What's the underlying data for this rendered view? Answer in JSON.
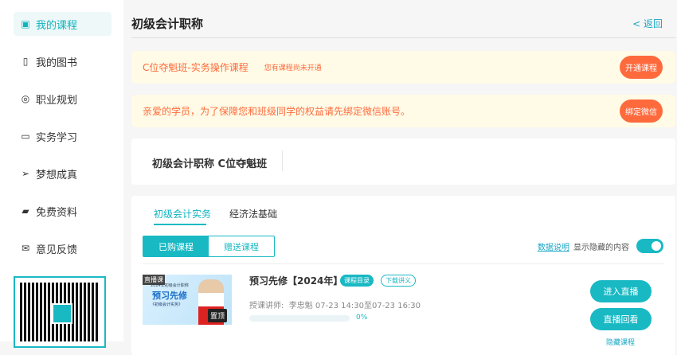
{
  "sidebar": {
    "items": [
      {
        "label": "我的课程",
        "icon": "bookmark-icon"
      },
      {
        "label": "我的图书",
        "icon": "book-icon"
      },
      {
        "label": "职业规划",
        "icon": "compass-icon"
      },
      {
        "label": "实务学习",
        "icon": "monitor-icon"
      },
      {
        "label": "梦想成真",
        "icon": "send-icon"
      },
      {
        "label": "免费资料",
        "icon": "folder-icon"
      },
      {
        "label": "意见反馈",
        "icon": "mail-icon"
      }
    ]
  },
  "header": {
    "title": "初级会计职称",
    "back": "< 返回"
  },
  "banner1": {
    "title": "C位夺魁班-实务操作课程",
    "note": "您有课程尚未开通",
    "button": "开通课程"
  },
  "banner2": {
    "text": "亲爱的学员，为了保障您和班级同学的权益请先绑定微信账号。",
    "button": "绑定微信"
  },
  "class_card": {
    "title": "初级会计职称 C位夺魁班"
  },
  "tabs": [
    "初级会计实务",
    "经济法基础"
  ],
  "segments": [
    "已购课程",
    "赠送课程"
  ],
  "data_link": "数据说明",
  "show_hidden": "显示隐藏的内容",
  "show_hidden_on": true,
  "course": {
    "thumb_badge": "直播课",
    "thumb_sub": "2024年初级会计职称",
    "thumb_title": "预习先修",
    "thumb_book": "《初级会计实务》",
    "pin": "置顶",
    "title": "预习先修【2024年】",
    "tag1": "课程目录",
    "tag2": "下载讲义",
    "teacher_label": "授课讲师:",
    "teacher": "李忠魁 07-23 14:30至07-23 16:30",
    "progress": 0,
    "progress_label": "0%",
    "btn_live": "进入直播",
    "btn_replay": "直播回看",
    "hide": "隐藏课程"
  },
  "colors": {
    "accent": "#19b9c4",
    "orange": "#ff6a3d"
  }
}
